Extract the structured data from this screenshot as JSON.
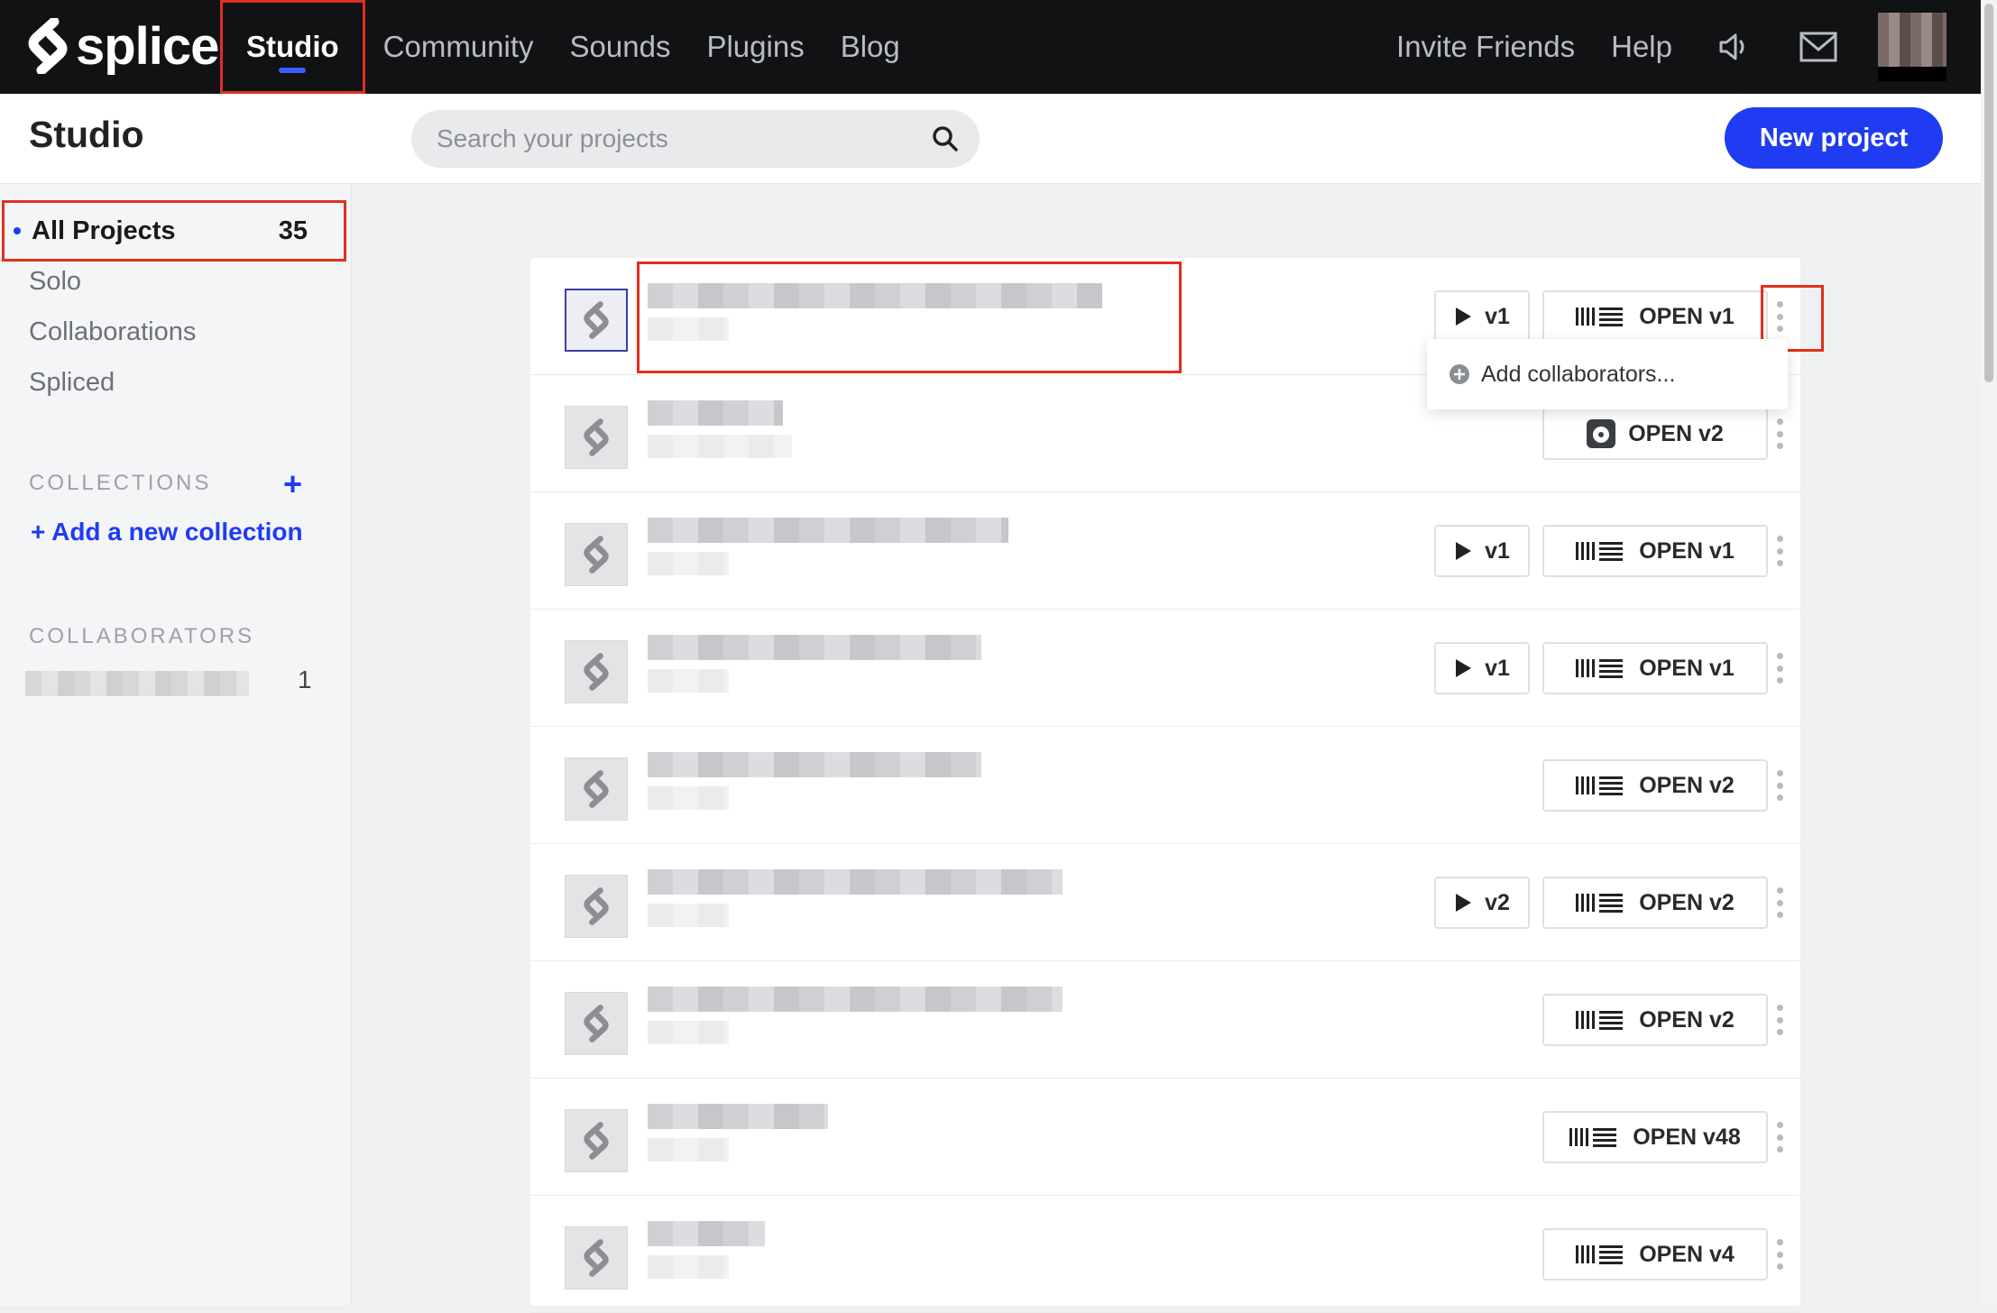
{
  "brand": {
    "name": "splice"
  },
  "nav": {
    "items": [
      {
        "label": "Studio",
        "active": true
      },
      {
        "label": "Community"
      },
      {
        "label": "Sounds"
      },
      {
        "label": "Plugins"
      },
      {
        "label": "Blog"
      }
    ],
    "invite": "Invite Friends",
    "help": "Help",
    "icons": [
      "speaker-icon",
      "mail-icon",
      "avatar"
    ]
  },
  "header": {
    "title": "Studio",
    "search_placeholder": "Search your projects",
    "new_project": "New project"
  },
  "sidebar": {
    "all_projects": {
      "label": "All Projects",
      "count": "35"
    },
    "items": [
      "Solo",
      "Collaborations",
      "Spliced"
    ],
    "collections_title": "COLLECTIONS",
    "add_collection": "+ Add a new collection",
    "collaborators_title": "COLLABORATORS",
    "collaborator_count": "1"
  },
  "projects": [
    {
      "play": "v1",
      "open": "OPEN v1",
      "daw": "bars"
    },
    {
      "play": null,
      "open": "OPEN v2",
      "daw": "disc"
    },
    {
      "play": "v1",
      "open": "OPEN v1",
      "daw": "bars"
    },
    {
      "play": "v1",
      "open": "OPEN v1",
      "daw": "bars"
    },
    {
      "play": null,
      "open": "OPEN v2",
      "daw": "bars"
    },
    {
      "play": "v2",
      "open": "OPEN v2",
      "daw": "bars"
    },
    {
      "play": null,
      "open": "OPEN v2",
      "daw": "bars"
    },
    {
      "play": null,
      "open": "OPEN v48",
      "daw": "bars"
    },
    {
      "play": null,
      "open": "OPEN v4",
      "daw": "bars"
    }
  ],
  "dropdown": {
    "label": "Add collaborators..."
  },
  "colors": {
    "accent": "#1f3cf2",
    "highlight": "#e0301e",
    "topbar": "#111214"
  }
}
